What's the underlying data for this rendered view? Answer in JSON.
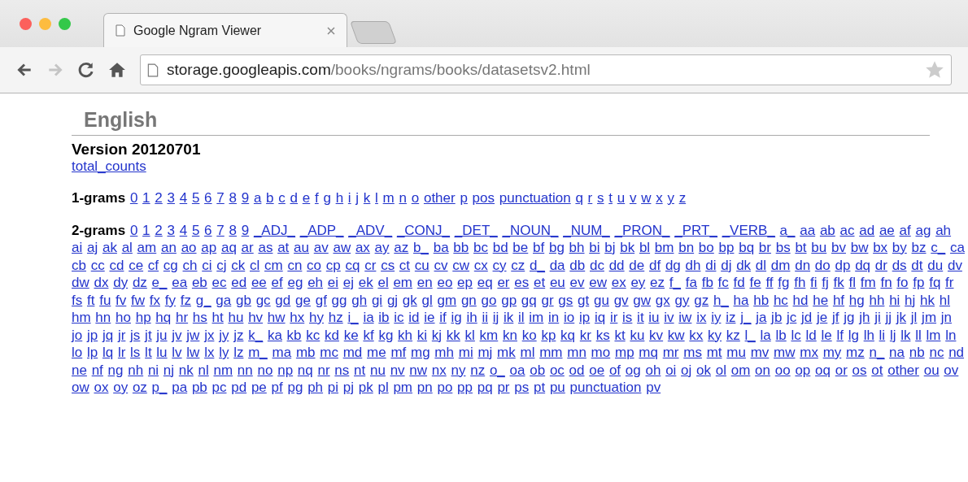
{
  "browser": {
    "tabs": [
      {
        "title": "Google Ngram Viewer",
        "selected": true
      }
    ],
    "nav_buttons": [
      {
        "kind": "back",
        "disabled": false
      },
      {
        "kind": "forward",
        "disabled": true
      },
      {
        "kind": "reload",
        "disabled": false
      },
      {
        "kind": "home",
        "disabled": false
      }
    ],
    "address": {
      "host": "storage.googleapis.com",
      "path": "/books/ngrams/books/datasetsv2.html"
    }
  },
  "page": {
    "heading": "English",
    "version": "Version 20120701",
    "total_counts": "total_counts",
    "sections": [
      {
        "label": "1-grams",
        "links": [
          "0",
          "1",
          "2",
          "3",
          "4",
          "5",
          "6",
          "7",
          "8",
          "9",
          "a",
          "b",
          "c",
          "d",
          "e",
          "f",
          "g",
          "h",
          "i",
          "j",
          "k",
          "l",
          "m",
          "n",
          "o",
          "other",
          "p",
          "pos",
          "punctuation",
          "q",
          "r",
          "s",
          "t",
          "u",
          "v",
          "w",
          "x",
          "y",
          "z"
        ]
      },
      {
        "label": "2-grams",
        "links": [
          "0",
          "1",
          "2",
          "3",
          "4",
          "5",
          "6",
          "7",
          "8",
          "9",
          "_ADJ_",
          "_ADP_",
          "_ADV_",
          "_CONJ_",
          "_DET_",
          "_NOUN_",
          "_NUM_",
          "_PRON_",
          "_PRT_",
          "_VERB_",
          "a_",
          "aa",
          "ab",
          "ac",
          "ad",
          "ae",
          "af",
          "ag",
          "ah",
          "ai",
          "aj",
          "ak",
          "al",
          "am",
          "an",
          "ao",
          "ap",
          "aq",
          "ar",
          "as",
          "at",
          "au",
          "av",
          "aw",
          "ax",
          "ay",
          "az",
          "b_",
          "ba",
          "bb",
          "bc",
          "bd",
          "be",
          "bf",
          "bg",
          "bh",
          "bi",
          "bj",
          "bk",
          "bl",
          "bm",
          "bn",
          "bo",
          "bp",
          "bq",
          "br",
          "bs",
          "bt",
          "bu",
          "bv",
          "bw",
          "bx",
          "by",
          "bz",
          "c_",
          "ca",
          "cb",
          "cc",
          "cd",
          "ce",
          "cf",
          "cg",
          "ch",
          "ci",
          "cj",
          "ck",
          "cl",
          "cm",
          "cn",
          "co",
          "cp",
          "cq",
          "cr",
          "cs",
          "ct",
          "cu",
          "cv",
          "cw",
          "cx",
          "cy",
          "cz",
          "d_",
          "da",
          "db",
          "dc",
          "dd",
          "de",
          "df",
          "dg",
          "dh",
          "di",
          "dj",
          "dk",
          "dl",
          "dm",
          "dn",
          "do",
          "dp",
          "dq",
          "dr",
          "ds",
          "dt",
          "du",
          "dv",
          "dw",
          "dx",
          "dy",
          "dz",
          "e_",
          "ea",
          "eb",
          "ec",
          "ed",
          "ee",
          "ef",
          "eg",
          "eh",
          "ei",
          "ej",
          "ek",
          "el",
          "em",
          "en",
          "eo",
          "ep",
          "eq",
          "er",
          "es",
          "et",
          "eu",
          "ev",
          "ew",
          "ex",
          "ey",
          "ez",
          "f_",
          "fa",
          "fb",
          "fc",
          "fd",
          "fe",
          "ff",
          "fg",
          "fh",
          "fi",
          "fj",
          "fk",
          "fl",
          "fm",
          "fn",
          "fo",
          "fp",
          "fq",
          "fr",
          "fs",
          "ft",
          "fu",
          "fv",
          "fw",
          "fx",
          "fy",
          "fz",
          "g_",
          "ga",
          "gb",
          "gc",
          "gd",
          "ge",
          "gf",
          "gg",
          "gh",
          "gi",
          "gj",
          "gk",
          "gl",
          "gm",
          "gn",
          "go",
          "gp",
          "gq",
          "gr",
          "gs",
          "gt",
          "gu",
          "gv",
          "gw",
          "gx",
          "gy",
          "gz",
          "h_",
          "ha",
          "hb",
          "hc",
          "hd",
          "he",
          "hf",
          "hg",
          "hh",
          "hi",
          "hj",
          "hk",
          "hl",
          "hm",
          "hn",
          "ho",
          "hp",
          "hq",
          "hr",
          "hs",
          "ht",
          "hu",
          "hv",
          "hw",
          "hx",
          "hy",
          "hz",
          "i_",
          "ia",
          "ib",
          "ic",
          "id",
          "ie",
          "if",
          "ig",
          "ih",
          "ii",
          "ij",
          "ik",
          "il",
          "im",
          "in",
          "io",
          "ip",
          "iq",
          "ir",
          "is",
          "it",
          "iu",
          "iv",
          "iw",
          "ix",
          "iy",
          "iz",
          "j_",
          "ja",
          "jb",
          "jc",
          "jd",
          "je",
          "jf",
          "jg",
          "jh",
          "ji",
          "jj",
          "jk",
          "jl",
          "jm",
          "jn",
          "jo",
          "jp",
          "jq",
          "jr",
          "js",
          "jt",
          "ju",
          "jv",
          "jw",
          "jx",
          "jy",
          "jz",
          "k_",
          "ka",
          "kb",
          "kc",
          "kd",
          "ke",
          "kf",
          "kg",
          "kh",
          "ki",
          "kj",
          "kk",
          "kl",
          "km",
          "kn",
          "ko",
          "kp",
          "kq",
          "kr",
          "ks",
          "kt",
          "ku",
          "kv",
          "kw",
          "kx",
          "ky",
          "kz",
          "l_",
          "la",
          "lb",
          "lc",
          "ld",
          "le",
          "lf",
          "lg",
          "lh",
          "li",
          "lj",
          "lk",
          "ll",
          "lm",
          "ln",
          "lo",
          "lp",
          "lq",
          "lr",
          "ls",
          "lt",
          "lu",
          "lv",
          "lw",
          "lx",
          "ly",
          "lz",
          "m_",
          "ma",
          "mb",
          "mc",
          "md",
          "me",
          "mf",
          "mg",
          "mh",
          "mi",
          "mj",
          "mk",
          "ml",
          "mm",
          "mn",
          "mo",
          "mp",
          "mq",
          "mr",
          "ms",
          "mt",
          "mu",
          "mv",
          "mw",
          "mx",
          "my",
          "mz",
          "n_",
          "na",
          "nb",
          "nc",
          "nd",
          "ne",
          "nf",
          "ng",
          "nh",
          "ni",
          "nj",
          "nk",
          "nl",
          "nm",
          "nn",
          "no",
          "np",
          "nq",
          "nr",
          "ns",
          "nt",
          "nu",
          "nv",
          "nw",
          "nx",
          "ny",
          "nz",
          "o_",
          "oa",
          "ob",
          "oc",
          "od",
          "oe",
          "of",
          "og",
          "oh",
          "oi",
          "oj",
          "ok",
          "ol",
          "om",
          "on",
          "oo",
          "op",
          "oq",
          "or",
          "os",
          "ot",
          "other",
          "ou",
          "ov",
          "ow",
          "ox",
          "oy",
          "oz",
          "p_",
          "pa",
          "pb",
          "pc",
          "pd",
          "pe",
          "pf",
          "pg",
          "ph",
          "pi",
          "pj",
          "pk",
          "pl",
          "pm",
          "pn",
          "po",
          "pp",
          "pq",
          "pr",
          "ps",
          "pt",
          "pu",
          "punctuation",
          "pv"
        ]
      }
    ]
  }
}
